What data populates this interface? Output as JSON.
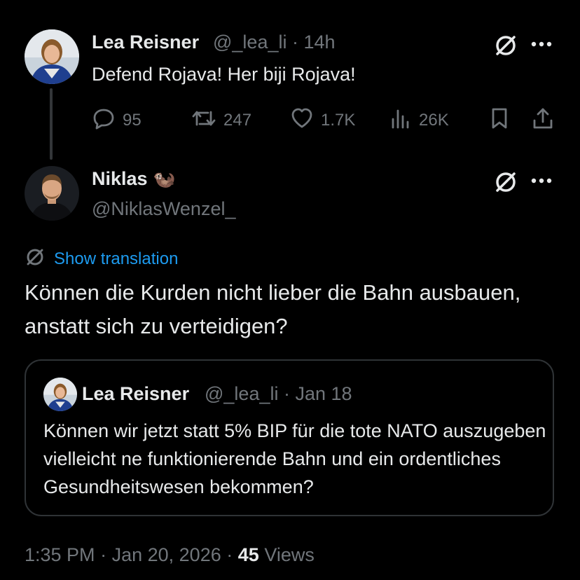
{
  "parent_tweet": {
    "author_name": "Lea Reisner",
    "handle": "@_lea_li",
    "separator": "·",
    "time": "14h",
    "text": "Defend Rojava! Her biji Rojava!",
    "stats": {
      "replies": "95",
      "reposts": "247",
      "likes": "1.7K",
      "views": "26K"
    }
  },
  "main_tweet": {
    "author_name": "Niklas",
    "author_emoji": "🦦",
    "handle": "@NiklasWenzel_",
    "show_translation": "Show translation",
    "text": "Können die Kurden nicht lieber die Bahn ausbauen, anstatt sich zu verteidigen?",
    "quote": {
      "author_name": "Lea Reisner",
      "handle": "@_lea_li",
      "separator": "·",
      "date": "Jan 18",
      "text": "Können wir jetzt statt 5% BIP für die tote NATO auszugeben vielleicht ne funktionierende Bahn und ein ordentliches Gesundheitswesen bekommen?"
    },
    "footer": {
      "time": "1:35 PM",
      "separator1": "·",
      "date": "Jan 20, 2026",
      "separator2": "·",
      "views_count": "45",
      "views_label": "Views"
    }
  },
  "colors": {
    "background": "#000000",
    "text": "#e7e9ea",
    "muted": "#71767b",
    "link": "#1d9bf0",
    "border": "#2f3336"
  },
  "icons": {
    "grok": "grok-slash-circle-icon",
    "more": "more-dots-icon",
    "reply": "reply-bubble-icon",
    "repost": "repost-icon",
    "like": "heart-icon",
    "views": "views-bars-icon",
    "bookmark": "bookmark-icon",
    "share": "share-icon",
    "translate": "translate-icon"
  }
}
